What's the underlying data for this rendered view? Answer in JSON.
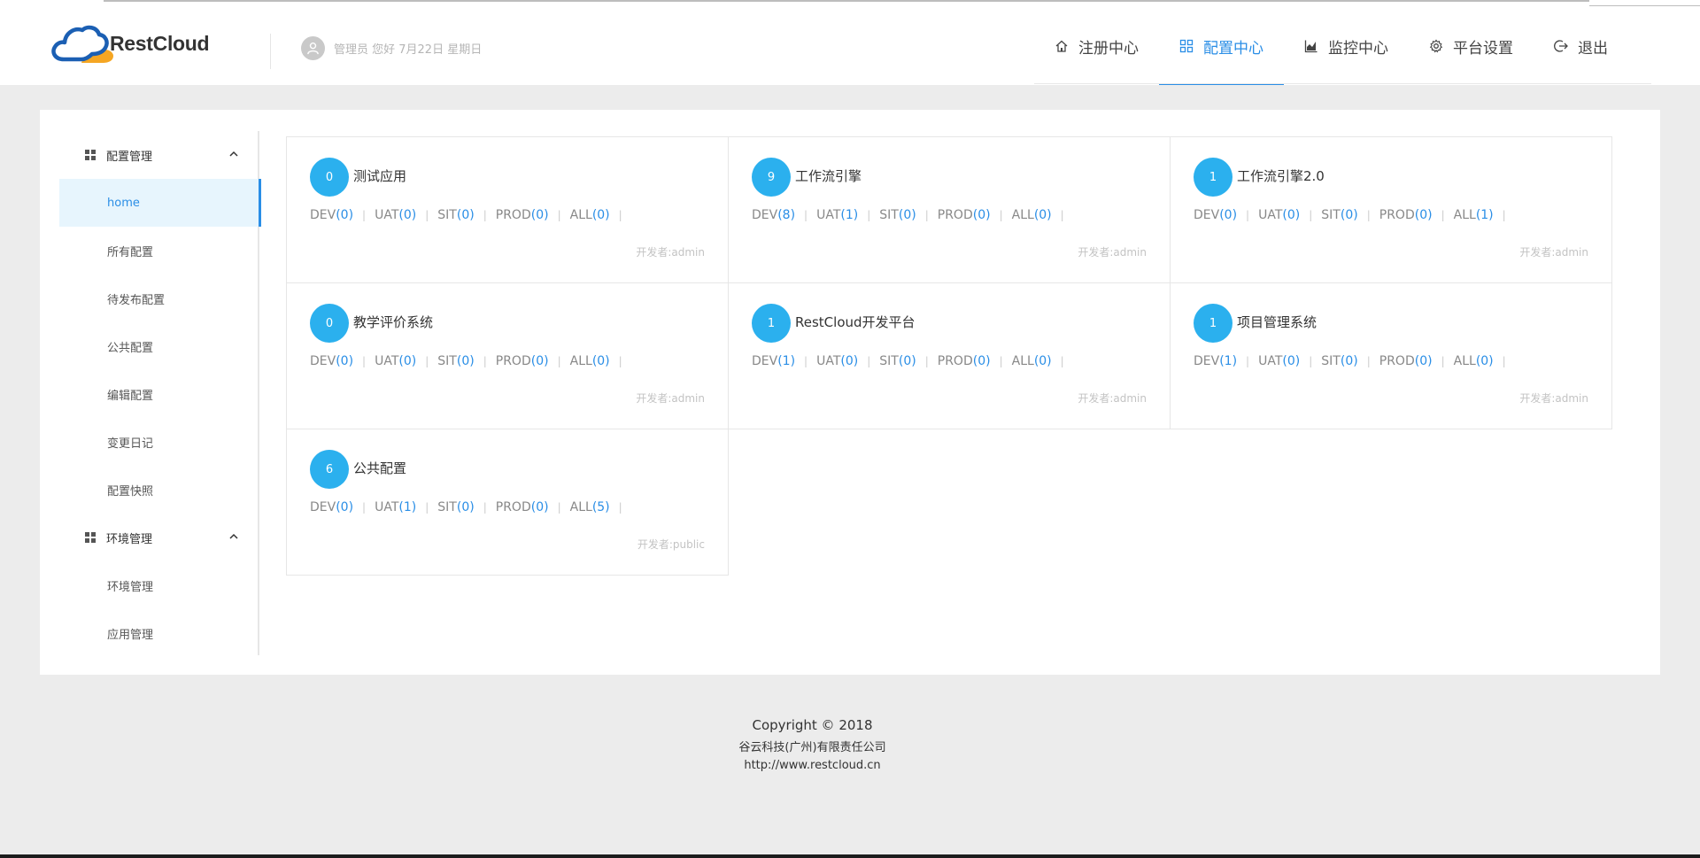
{
  "brand": {
    "name": "RestCloud"
  },
  "user": {
    "greeting": "管理员 您好 7月22日 星期日"
  },
  "nav": {
    "items": [
      {
        "label": "注册中心",
        "icon": "home-icon",
        "active": false
      },
      {
        "label": "配置中心",
        "icon": "grid-icon",
        "active": true
      },
      {
        "label": "监控中心",
        "icon": "chart-icon",
        "active": false
      },
      {
        "label": "平台设置",
        "icon": "gear-icon",
        "active": false
      },
      {
        "label": "退出",
        "icon": "logout-icon",
        "active": false
      }
    ]
  },
  "sidebar": {
    "groups": [
      {
        "title": "配置管理",
        "items": [
          {
            "label": "home",
            "active": true
          },
          {
            "label": "所有配置",
            "active": false
          },
          {
            "label": "待发布配置",
            "active": false
          },
          {
            "label": "公共配置",
            "active": false
          },
          {
            "label": "编辑配置",
            "active": false
          },
          {
            "label": "变更日记",
            "active": false
          },
          {
            "label": "配置快照",
            "active": false
          }
        ]
      },
      {
        "title": "环境管理",
        "items": [
          {
            "label": "环境管理",
            "active": false
          },
          {
            "label": "应用管理",
            "active": false
          }
        ]
      }
    ]
  },
  "cards": [
    {
      "count": "0",
      "title": "测试应用",
      "envs": [
        [
          "DEV",
          "(0)"
        ],
        [
          "UAT",
          "(0)"
        ],
        [
          "SIT",
          "(0)"
        ],
        [
          "PROD",
          "(0)"
        ],
        [
          "ALL",
          "(0)"
        ]
      ],
      "developer": "开发者:admin"
    },
    {
      "count": "9",
      "title": "工作流引擎",
      "envs": [
        [
          "DEV",
          "(8)"
        ],
        [
          "UAT",
          "(1)"
        ],
        [
          "SIT",
          "(0)"
        ],
        [
          "PROD",
          "(0)"
        ],
        [
          "ALL",
          "(0)"
        ]
      ],
      "developer": "开发者:admin"
    },
    {
      "count": "1",
      "title": "工作流引擎2.0",
      "envs": [
        [
          "DEV",
          "(0)"
        ],
        [
          "UAT",
          "(0)"
        ],
        [
          "SIT",
          "(0)"
        ],
        [
          "PROD",
          "(0)"
        ],
        [
          "ALL",
          "(1)"
        ]
      ],
      "developer": "开发者:admin"
    },
    {
      "count": "0",
      "title": "教学评价系统",
      "envs": [
        [
          "DEV",
          "(0)"
        ],
        [
          "UAT",
          "(0)"
        ],
        [
          "SIT",
          "(0)"
        ],
        [
          "PROD",
          "(0)"
        ],
        [
          "ALL",
          "(0)"
        ]
      ],
      "developer": "开发者:admin"
    },
    {
      "count": "1",
      "title": "RestCloud开发平台",
      "envs": [
        [
          "DEV",
          "(1)"
        ],
        [
          "UAT",
          "(0)"
        ],
        [
          "SIT",
          "(0)"
        ],
        [
          "PROD",
          "(0)"
        ],
        [
          "ALL",
          "(0)"
        ]
      ],
      "developer": "开发者:admin"
    },
    {
      "count": "1",
      "title": "项目管理系统",
      "envs": [
        [
          "DEV",
          "(1)"
        ],
        [
          "UAT",
          "(0)"
        ],
        [
          "SIT",
          "(0)"
        ],
        [
          "PROD",
          "(0)"
        ],
        [
          "ALL",
          "(0)"
        ]
      ],
      "developer": "开发者:admin"
    },
    {
      "count": "6",
      "title": "公共配置",
      "envs": [
        [
          "DEV",
          "(0)"
        ],
        [
          "UAT",
          "(1)"
        ],
        [
          "SIT",
          "(0)"
        ],
        [
          "PROD",
          "(0)"
        ],
        [
          "ALL",
          "(5)"
        ]
      ],
      "developer": "开发者:public"
    }
  ],
  "footer": {
    "copyright": "Copyright © 2018",
    "company": "谷云科技(广州)有限责任公司",
    "url": "http://www.restcloud.cn"
  },
  "colors": {
    "accent": "#2a8ee6",
    "badge": "#2bb0ee",
    "logo_blue": "#1b5fb3",
    "logo_orange": "#f5a623"
  }
}
